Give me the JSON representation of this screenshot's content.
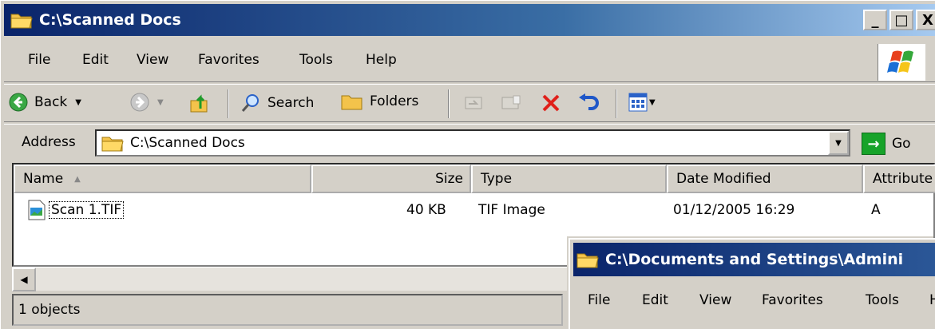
{
  "window": {
    "title": "C:\\Scanned Docs",
    "buttons": {
      "minimize": "_",
      "maximize": "□",
      "close": "X"
    },
    "menu": [
      "File",
      "Edit",
      "View",
      "Favorites",
      "Tools",
      "Help"
    ],
    "toolbar": {
      "back": "Back",
      "search": "Search",
      "folders": "Folders"
    },
    "address": {
      "label": "Address",
      "value": "C:\\Scanned Docs",
      "go": "Go"
    },
    "columns": [
      "Name",
      "Size",
      "Type",
      "Date Modified",
      "Attribute"
    ],
    "files": [
      {
        "name": "Scan 1.TIF",
        "size": "40 KB",
        "type": "TIF Image",
        "date": "01/12/2005 16:29",
        "attr": "A"
      }
    ],
    "status": "1 objects"
  },
  "window2": {
    "title": "C:\\Documents and Settings\\Admini",
    "menu": [
      "File",
      "Edit",
      "View",
      "Favorites",
      "Tools",
      "H"
    ]
  },
  "colors": {
    "titlebar_start": "#0a246a",
    "titlebar_end": "#a6caf0",
    "face": "#d4d0c8",
    "delete_red": "#e0201a",
    "go_green": "#17a32a"
  }
}
